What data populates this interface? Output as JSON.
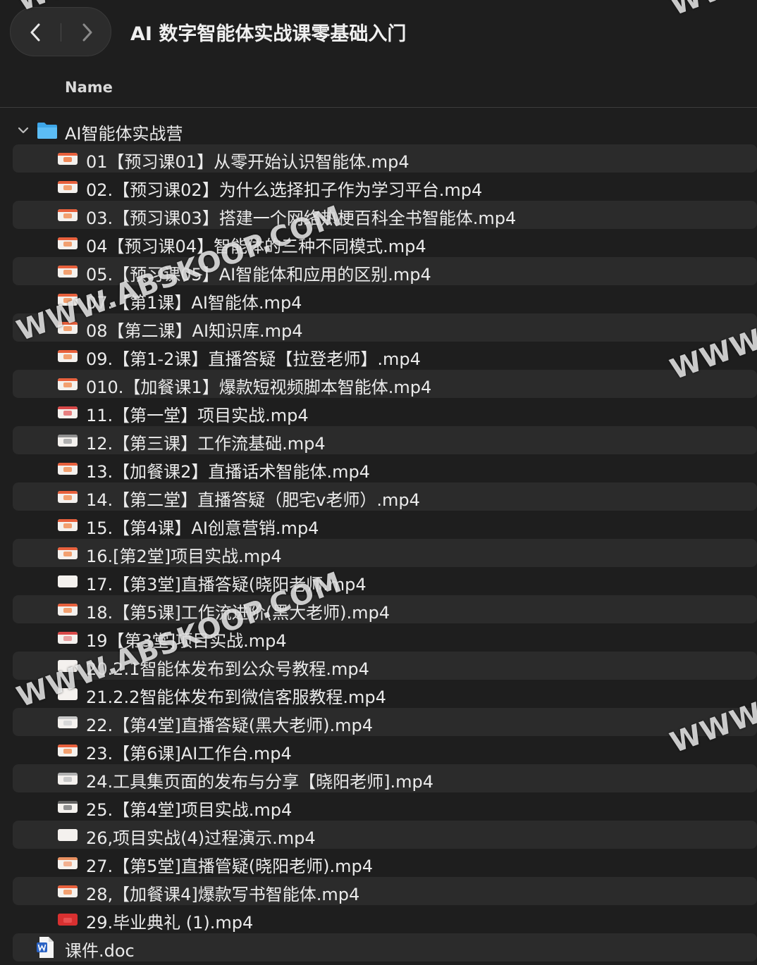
{
  "window": {
    "title": "AI 数字智能体实战课零基础入门"
  },
  "column_header": {
    "name": "Name"
  },
  "folder": {
    "name": "AI智能体实战营",
    "expanded": true,
    "icon": "folder-icon"
  },
  "files": [
    {
      "name": "01【预习课01】从零开始认识智能体.mp4",
      "icon": "video-file-icon"
    },
    {
      "name": "02.【预习课02】为什么选择扣子作为学习平台.mp4",
      "icon": "video-file-icon"
    },
    {
      "name": "03.【预习课03】搭建一个网络热梗百科全书智能体.mp4",
      "icon": "video-file-icon"
    },
    {
      "name": "04【预习课04】智能体的三种不同模式.mp4",
      "icon": "video-file-icon"
    },
    {
      "name": "05.【预习课05】AI智能体和应用的区别.mp4",
      "icon": "video-file-icon"
    },
    {
      "name": "07.【第1课】AI智能体.mp4",
      "icon": "video-file-icon"
    },
    {
      "name": "08【第二课】AI知识库.mp4",
      "icon": "video-file-icon"
    },
    {
      "name": "09.【第1-2课】直播答疑【拉登老师】.mp4",
      "icon": "video-file-icon"
    },
    {
      "name": "010.【加餐课1】爆款短视频脚本智能体.mp4",
      "icon": "video-file-icon"
    },
    {
      "name": "11.【第一堂】项目实战.mp4",
      "icon": "video-file-icon"
    },
    {
      "name": "12.【第三课】工作流基础.mp4",
      "icon": "video-file-icon"
    },
    {
      "name": "13.【加餐课2】直播话术智能体.mp4",
      "icon": "video-file-icon"
    },
    {
      "name": "14.【第二堂】直播答疑（肥宅v老师）.mp4",
      "icon": "video-file-icon"
    },
    {
      "name": "15.【第4课】AI创意营销.mp4",
      "icon": "video-file-icon"
    },
    {
      "name": "16.[第2堂]项目实战.mp4",
      "icon": "video-file-icon"
    },
    {
      "name": "17.【第3堂]直播答疑(晓阳老师.mp4",
      "icon": "video-file-icon"
    },
    {
      "name": "18.【第5课]工作流进阶(黑大老师).mp4",
      "icon": "video-file-icon"
    },
    {
      "name": "19【第3堂]项目实战.mp4",
      "icon": "video-file-icon"
    },
    {
      "name": "20.2.1智能体发布到公众号教程.mp4",
      "icon": "video-file-icon"
    },
    {
      "name": "21.2.2智能体发布到微信客服教程.mp4",
      "icon": "video-file-icon"
    },
    {
      "name": "22.【第4堂]直播答疑(黑大老师).mp4",
      "icon": "video-file-icon"
    },
    {
      "name": "23.【第6课]AI工作台.mp4",
      "icon": "video-file-icon"
    },
    {
      "name": "24.工具集页面的发布与分享【晓阳老师].mp4",
      "icon": "video-file-icon"
    },
    {
      "name": "25.【第4堂]项目实战.mp4",
      "icon": "video-file-icon"
    },
    {
      "name": "26,项目实战(4)过程演示.mp4",
      "icon": "video-file-icon"
    },
    {
      "name": "27.【第5堂]直播管疑(晓阳老师).mp4",
      "icon": "video-file-icon"
    },
    {
      "name": "28,【加餐课4]爆款写书智能体.mp4",
      "icon": "video-file-icon"
    },
    {
      "name": "29.毕业典礼 (1).mp4",
      "icon": "video-file-icon"
    }
  ],
  "top_files": [
    {
      "name": "课件.doc",
      "icon": "word-doc-icon"
    }
  ],
  "watermarks": [
    {
      "text": "WWW.ABSKOOP.COM"
    },
    {
      "text": "WWW.ABSKOOP.COM"
    },
    {
      "text": "WWW"
    },
    {
      "text": "WWW"
    },
    {
      "text": "WWW"
    },
    {
      "text": "WWW"
    }
  ]
}
